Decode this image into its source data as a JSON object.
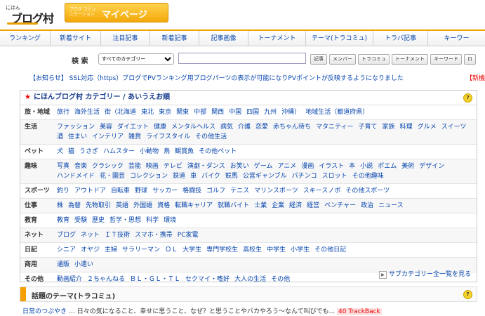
{
  "logo": {
    "small": "にほん",
    "big": "ブログ村"
  },
  "mypage": {
    "sub": "ブログ コミュニケーション",
    "main": "マイページ"
  },
  "nav": {
    "tabs": [
      "ランキング",
      "新着サイト",
      "注目記事",
      "新着記事",
      "記事画像",
      "トーナメント",
      "テーマ(トラコミュ)",
      "トラバ記事",
      "キーワー"
    ]
  },
  "search": {
    "label": "検 索",
    "category_selected": "すべてのカテゴリー",
    "input_value": "",
    "buttons": [
      "記事",
      "メンバー",
      "トラコミュ",
      "トーナメント",
      "キーワード",
      "ロ"
    ]
  },
  "notice": {
    "text": "【お知らせ】 SSL対応（https）ブログでPVランキング用ブログパーツの表示が可能になりPVポイントが反映するようになりました",
    "right": "【新機"
  },
  "category": {
    "title": "にほんブログ村 カテゴリー / あいうえお順",
    "rows": [
      {
        "label": "旅・地域",
        "links": [
          "旅行",
          "海外生活",
          "街（北海道",
          "東北",
          "東京",
          "関東",
          "中部",
          "関西",
          "中国",
          "四国",
          "九州",
          "沖縄）",
          "地域生活（都道府県）"
        ]
      },
      {
        "label": "生活",
        "links": [
          "ファッション",
          "美容",
          "ダイエット",
          "健康",
          "メンタルヘルス",
          "病気",
          "介護",
          "恋愛",
          "赤ちゃん待ち",
          "マタニティー",
          "子育て",
          "家族",
          "料理",
          "グルメ",
          "スイーツ",
          "酒",
          "住まい",
          "インテリア",
          "雑貨",
          "ライフスタイル",
          "その他生活"
        ]
      },
      {
        "label": "ペット",
        "links": [
          "犬",
          "猫",
          "うさぎ",
          "ハムスター",
          "小動物",
          "鳥",
          "観賞魚",
          "その他ペット"
        ]
      },
      {
        "label": "趣味",
        "links": [
          "写真",
          "音楽",
          "クラシック",
          "芸能",
          "映画",
          "テレビ",
          "演劇・ダンス",
          "お笑い",
          "ゲーム",
          "アニメ",
          "漫画",
          "イラスト",
          "本",
          "小説",
          "ポエム",
          "美術",
          "デザイン",
          "ハンドメイド",
          "花・園芸",
          "コレクション",
          "鉄道",
          "車",
          "バイク",
          "競馬",
          "公営ギャンブル",
          "パチンコ",
          "スロット",
          "その他趣味"
        ]
      },
      {
        "label": "スポーツ",
        "links": [
          "釣り",
          "アウトドア",
          "自転車",
          "野球",
          "サッカー",
          "格闘技",
          "ゴルフ",
          "テニス",
          "マリンスポーツ",
          "スキースノボ",
          "その他スポーツ"
        ]
      },
      {
        "label": "仕事",
        "links": [
          "株",
          "為替",
          "先物取引",
          "英語",
          "外国語",
          "資格",
          "転職キャリア",
          "就職バイト",
          "士業",
          "企業",
          "経済",
          "経営",
          "ベンチャー",
          "政治",
          "ニュース"
        ]
      },
      {
        "label": "教育",
        "links": [
          "教育",
          "受験",
          "歴史",
          "哲学・思想",
          "科学",
          "環境"
        ]
      },
      {
        "label": "ネット",
        "links": [
          "ブログ",
          "ネット",
          "ＩＴ技術",
          "スマホ・携帯",
          "PC家電"
        ]
      },
      {
        "label": "日記",
        "links": [
          "シニア",
          "オヤジ",
          "主婦",
          "サラリーマン",
          "ＯＬ",
          "大学生",
          "専門学校生",
          "高校生",
          "中学生",
          "小学生",
          "その他日記"
        ]
      },
      {
        "label": "商用",
        "links": [
          "通販",
          "小遣い"
        ]
      },
      {
        "label": "その他",
        "links": [
          "動画紹介",
          "２ちゃんねる",
          "ＢＬ・ＧＬ・ＴＬ",
          "セクマイ・嗜好",
          "大人の生活",
          "その他"
        ]
      }
    ],
    "more": "サブカテゴリー全一覧を見る"
  },
  "theme": {
    "title": "話題のテーマ(トラコミュ)",
    "entry_link": "日常のつぶやき",
    "entry_desc": "… 日々の気になること、幸せに思うこと、なぜ？と思うことやバカやろう～なんて叫びでも...",
    "entry_trackback": "40 TrackBack"
  },
  "colors": {
    "accent": "#f0a000",
    "link": "#0645ad",
    "alert": "#e00000"
  }
}
